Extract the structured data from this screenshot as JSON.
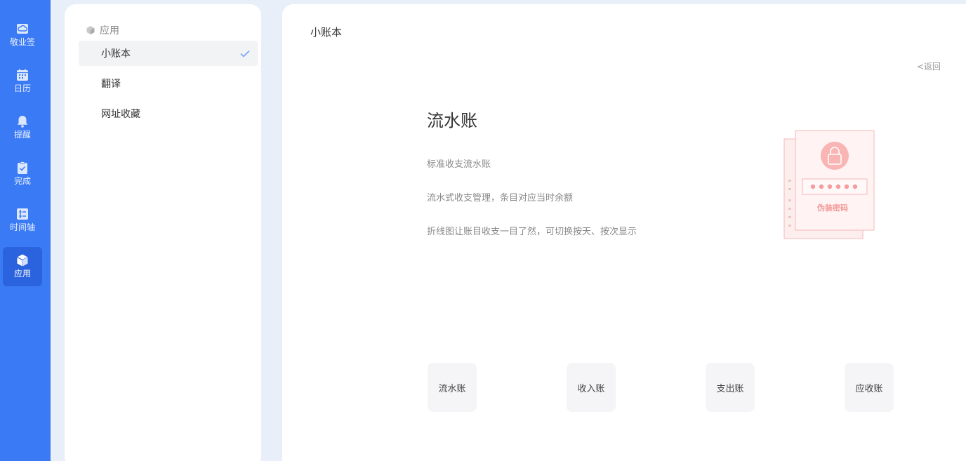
{
  "rail": {
    "items": [
      {
        "label": "敬业签",
        "icon": "cloud-note-icon"
      },
      {
        "label": "日历",
        "icon": "calendar-icon"
      },
      {
        "label": "提醒",
        "icon": "bell-icon"
      },
      {
        "label": "完成",
        "icon": "clipboard-check-icon"
      },
      {
        "label": "时间轴",
        "icon": "timeline-icon"
      },
      {
        "label": "应用",
        "icon": "cube-icon"
      }
    ],
    "active_index": 5,
    "colors": {
      "bg": "#3a7af5",
      "active": "#2a63dd"
    }
  },
  "subpanel": {
    "header": "应用",
    "items": [
      {
        "label": "小账本",
        "selected": true
      },
      {
        "label": "翻译",
        "selected": false
      },
      {
        "label": "网址收藏",
        "selected": false
      }
    ]
  },
  "main": {
    "title": "小账本",
    "back_label": "<返回",
    "feature": {
      "title": "流水账",
      "lines": [
        "标准收支流水账",
        "流水式收支管理，条目对应当时余额",
        "折线图让账目收支一目了然，可切换按天、按次显示"
      ],
      "illustration_caption": "伪装密码"
    },
    "tiles": [
      "流水账",
      "收入账",
      "支出账",
      "应收账"
    ]
  }
}
